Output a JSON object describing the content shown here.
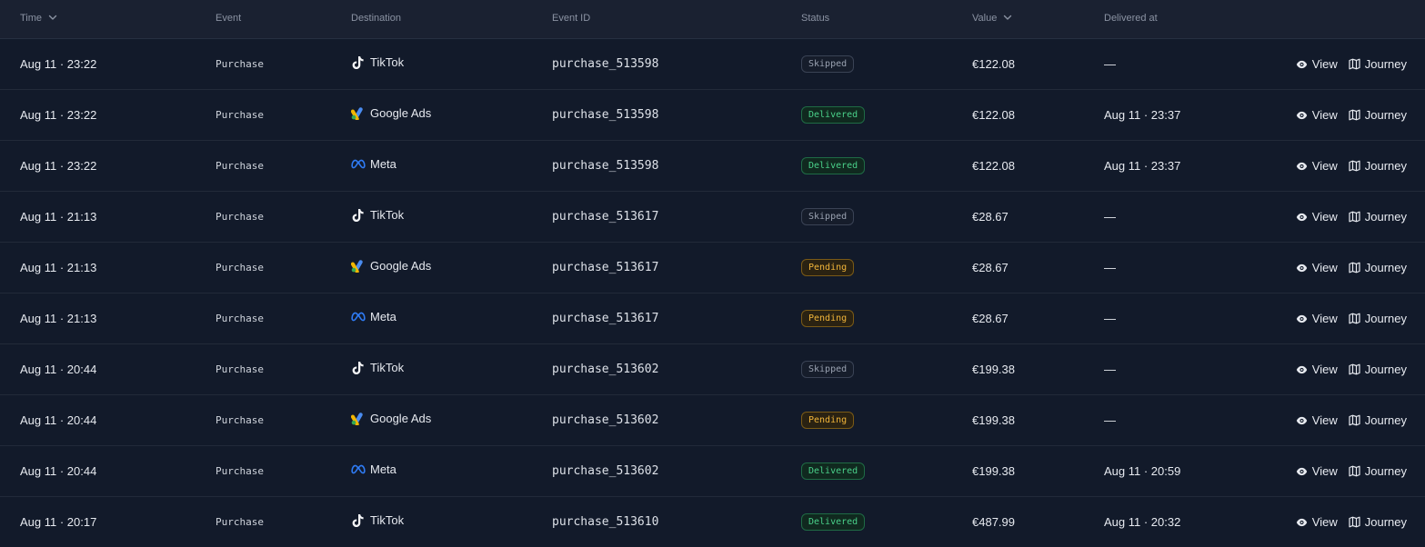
{
  "header": {
    "time": "Time",
    "event": "Event",
    "destination": "Destination",
    "event_id": "Event ID",
    "status": "Status",
    "value": "Value",
    "delivered_at": "Delivered at"
  },
  "actions": {
    "view": "View",
    "journey": "Journey"
  },
  "colors": {
    "delivered": "#4ad18a",
    "pending": "#f1b53a",
    "skipped": "#9aa2b1",
    "background": "#111827"
  },
  "rows": [
    {
      "time": "Aug 11 · 23:22",
      "event": "Purchase",
      "destination": "TikTok",
      "dest_icon": "tiktok-icon",
      "event_id": "purchase_513598",
      "status": "Skipped",
      "value": "€122.08",
      "delivered_at": "—"
    },
    {
      "time": "Aug 11 · 23:22",
      "event": "Purchase",
      "destination": "Google Ads",
      "dest_icon": "google-ads-icon",
      "event_id": "purchase_513598",
      "status": "Delivered",
      "value": "€122.08",
      "delivered_at": "Aug 11 · 23:37"
    },
    {
      "time": "Aug 11 · 23:22",
      "event": "Purchase",
      "destination": "Meta",
      "dest_icon": "meta-icon",
      "event_id": "purchase_513598",
      "status": "Delivered",
      "value": "€122.08",
      "delivered_at": "Aug 11 · 23:37"
    },
    {
      "time": "Aug 11 · 21:13",
      "event": "Purchase",
      "destination": "TikTok",
      "dest_icon": "tiktok-icon",
      "event_id": "purchase_513617",
      "status": "Skipped",
      "value": "€28.67",
      "delivered_at": "—"
    },
    {
      "time": "Aug 11 · 21:13",
      "event": "Purchase",
      "destination": "Google Ads",
      "dest_icon": "google-ads-icon",
      "event_id": "purchase_513617",
      "status": "Pending",
      "value": "€28.67",
      "delivered_at": "—"
    },
    {
      "time": "Aug 11 · 21:13",
      "event": "Purchase",
      "destination": "Meta",
      "dest_icon": "meta-icon",
      "event_id": "purchase_513617",
      "status": "Pending",
      "value": "€28.67",
      "delivered_at": "—"
    },
    {
      "time": "Aug 11 · 20:44",
      "event": "Purchase",
      "destination": "TikTok",
      "dest_icon": "tiktok-icon",
      "event_id": "purchase_513602",
      "status": "Skipped",
      "value": "€199.38",
      "delivered_at": "—"
    },
    {
      "time": "Aug 11 · 20:44",
      "event": "Purchase",
      "destination": "Google Ads",
      "dest_icon": "google-ads-icon",
      "event_id": "purchase_513602",
      "status": "Pending",
      "value": "€199.38",
      "delivered_at": "—"
    },
    {
      "time": "Aug 11 · 20:44",
      "event": "Purchase",
      "destination": "Meta",
      "dest_icon": "meta-icon",
      "event_id": "purchase_513602",
      "status": "Delivered",
      "value": "€199.38",
      "delivered_at": "Aug 11 · 20:59"
    },
    {
      "time": "Aug 11 · 20:17",
      "event": "Purchase",
      "destination": "TikTok",
      "dest_icon": "tiktok-icon",
      "event_id": "purchase_513610",
      "status": "Delivered",
      "value": "€487.99",
      "delivered_at": "Aug 11 · 20:32"
    }
  ]
}
